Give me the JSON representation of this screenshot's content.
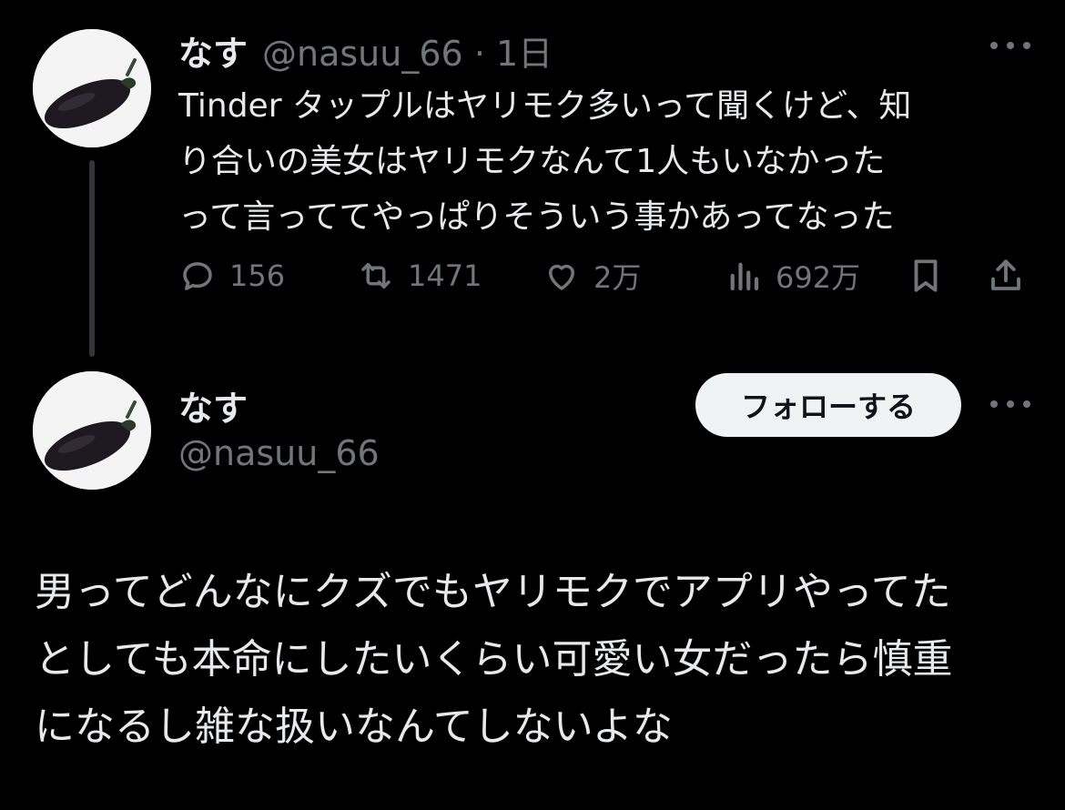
{
  "quoted_tweet": {
    "author_name": "なす",
    "author_handle": "@nasuu_66",
    "separator": "·",
    "time_ago": "1日",
    "text_lines": [
      "Tinder タップルはヤリモク多いって聞くけど、知",
      "り合いの美女はヤリモクなんて1人もいなかった",
      "って言っててやっぱりそういう事かあってなった"
    ],
    "metrics": {
      "replies": "156",
      "retweets": "1471",
      "likes": "2万",
      "views": "692万"
    },
    "icons": [
      "reply-icon",
      "retweet-icon",
      "like-icon",
      "views-icon",
      "bookmark-icon",
      "share-icon",
      "more-icon"
    ]
  },
  "main_tweet": {
    "author_name": "なす",
    "author_handle": "@nasuu_66",
    "follow_label": "フォローする",
    "text_lines": [
      "男ってどんなにクズでもヤリモクでアプリやってた",
      "としても本命にしたいくらい可愛い女だったら慎重",
      "になるし雑な扱いなんてしないよな"
    ]
  },
  "colors": {
    "background": "#000000",
    "text": "#e7e9ea",
    "muted": "#71767b",
    "follow_button_bg": "#eff3f4",
    "thread_line": "#333639"
  }
}
